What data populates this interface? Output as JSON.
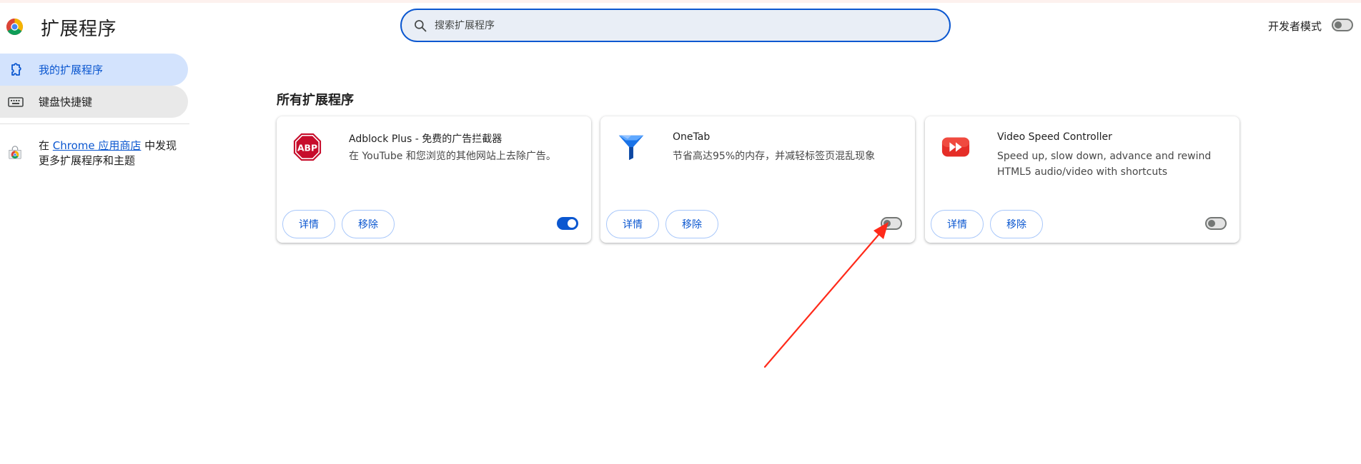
{
  "header": {
    "title": "扩展程序",
    "search_placeholder": "搜索扩展程序",
    "dev_mode_label": "开发者模式",
    "dev_mode_on": false
  },
  "sidebar": {
    "items": [
      {
        "label": "我的扩展程序",
        "icon": "puzzle-icon",
        "active": true
      },
      {
        "label": "键盘快捷键",
        "icon": "keyboard-icon",
        "active": false
      }
    ],
    "store": {
      "prefix": "在 ",
      "link": "Chrome 应用商店",
      "suffix": " 中发现更多扩展程序和主题",
      "icon": "chrome-web-store-icon"
    }
  },
  "main": {
    "section_title": "所有扩展程序",
    "extensions": [
      {
        "name": "Adblock Plus - 免费的广告拦截器",
        "description": "在 YouTube 和您浏览的其他网站上去除广告。",
        "icon": "abp-icon",
        "icon_text": "ABP",
        "enabled": true,
        "details_label": "详情",
        "remove_label": "移除"
      },
      {
        "name": "OneTab",
        "description": "节省高达95%的内存，并减轻标签页混乱现象",
        "icon": "onetab-funnel-icon",
        "enabled": false,
        "details_label": "详情",
        "remove_label": "移除"
      },
      {
        "name": "Video Speed Controller",
        "description": "Speed up, slow down, advance and rewind HTML5 audio/video with shortcuts",
        "icon": "fast-forward-icon",
        "enabled": false,
        "details_label": "详情",
        "remove_label": "移除"
      }
    ]
  },
  "colors": {
    "accent": "#0b57d0",
    "sidebar_active_bg": "#d3e3fd",
    "annotation_arrow": "#ff2a1a"
  }
}
